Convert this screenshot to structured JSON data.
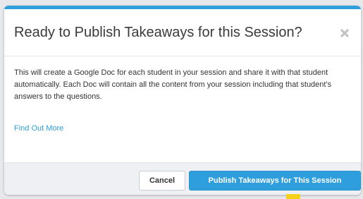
{
  "modal": {
    "title": "Ready to Publish Takeaways for this Session?",
    "body_text": "This will create a Google Doc for each student in your session and share it with that student automatically. Each Doc will contain all the content from your session including that student's answers to the questions.",
    "learn_more_link": "Find Out More",
    "close_icon": "close-x-icon"
  },
  "footer": {
    "cancel_label": "Cancel",
    "publish_label": "Publish Takeaways for This Session"
  },
  "colors": {
    "accent": "#2e9fdc",
    "footer_bg": "#eef0f4",
    "backdrop": "#e6e8ec"
  }
}
